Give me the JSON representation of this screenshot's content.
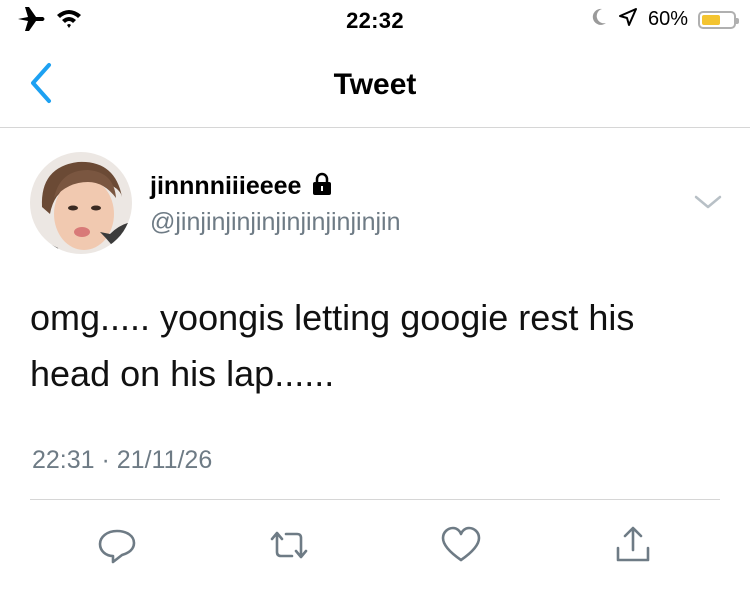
{
  "status_bar": {
    "time": "22:32",
    "battery_percent_text": "60%",
    "battery_level": 0.6,
    "icons": [
      "airplane-icon",
      "wifi-icon",
      "moon-icon",
      "location-arrow-icon",
      "battery-icon"
    ]
  },
  "nav": {
    "title": "Tweet",
    "back_icon": "chevron-left-icon"
  },
  "tweet": {
    "author_name": "jinnnniiieeee",
    "author_handle": "@jinjinjinjinjinjinjinjinjin",
    "locked_icon": "lock-icon",
    "text": "omg..... yoongis letting googie rest his head on his lap......",
    "timestamp": "22:31 · 21/11/26"
  },
  "actions": {
    "icons": [
      "reply-icon",
      "retweet-icon",
      "like-icon",
      "share-icon"
    ]
  },
  "colors": {
    "accent": "#1da1f2",
    "secondary_text": "#6e7b85",
    "divider": "#d6d6d6",
    "battery": "#f4c430"
  }
}
